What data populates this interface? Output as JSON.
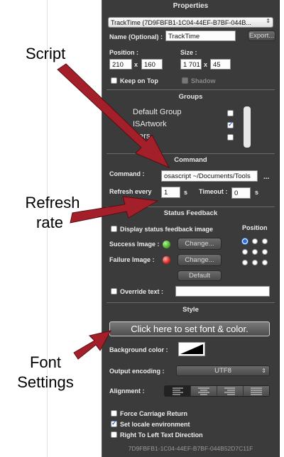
{
  "annotations": {
    "script": "Script",
    "refresh_line1": "Refresh",
    "refresh_line2": "rate",
    "font_line1": "Font",
    "font_line2": "Settings"
  },
  "panel": {
    "title": "Properties",
    "selector_value": "TrackTime (7D9FBFB1-1C04-44EF-B7BF-044B...",
    "name_label": "Name (Optional) :",
    "name_value": "TrackTime",
    "export_label": "Export...",
    "position_label": "Position :",
    "pos_x": "210",
    "pos_y": "160",
    "x_sep": "x",
    "size_label": "Size :",
    "size_w": "1 701",
    "size_h": "45",
    "keep_on_top": "Keep on Top",
    "shadow": "Shadow",
    "groups_header": "Groups",
    "groups": [
      {
        "label": "Default Group",
        "checked": false
      },
      {
        "label": "ISArtwork",
        "checked": true
      },
      {
        "label": "...ers",
        "checked": false
      }
    ],
    "command_header": "Command",
    "command_label": "Command :",
    "command_value": "osascript ~/Documents/Tools",
    "command_browse": "...",
    "refresh_label": "Refresh every",
    "refresh_value": "1",
    "refresh_unit": "s",
    "timeout_label": "Timeout :",
    "timeout_value": "0",
    "timeout_unit": "s",
    "status_header": "Status Feedback",
    "display_status": "Display status feedback image",
    "position_header": "Position",
    "success_label": "Success Image :",
    "failure_label": "Failure Image :",
    "change_label": "Change...",
    "default_label": "Default",
    "override_label": "Override text :",
    "override_value": "",
    "style_header": "Style",
    "font_button": "Click here to set font & color.",
    "bg_color_label": "Background color :",
    "encoding_label": "Output encoding :",
    "encoding_value": "UTF8",
    "alignment_label": "Alignment :",
    "force_cr": "Force Carriage Return",
    "set_locale": "Set locale environment",
    "rtl": "Right To Left Text Direction",
    "footer_id": "7D9FBFB1-1C04-44EF-B7BF-044B52D7C11F"
  },
  "colors": {
    "panel_bg": "#3b3b3b",
    "arrow": "#a3202a",
    "success_dot": "#4caf2a",
    "failure_dot": "#d4261f",
    "radio_selected": "#2d6fd8"
  }
}
